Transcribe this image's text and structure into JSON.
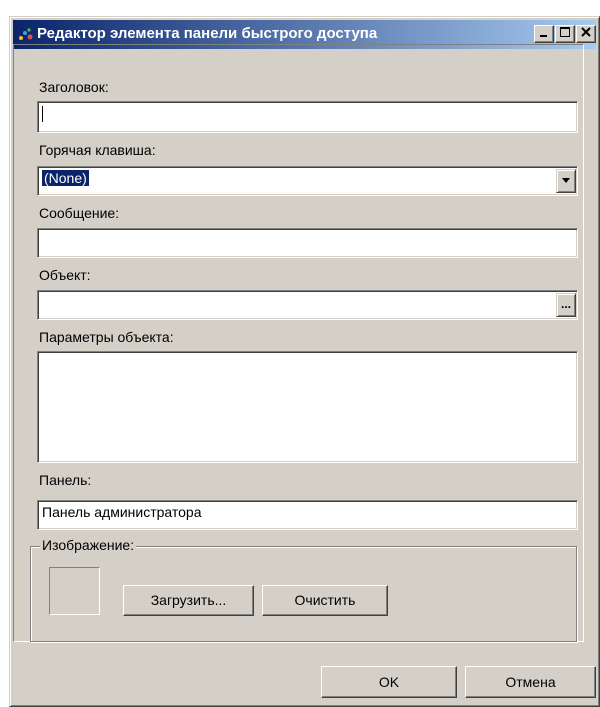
{
  "window": {
    "title": "Редактор элемента панели быстрого доступа",
    "icon": "quick-access-panel-icon",
    "controls": {
      "minimize": "minimize-icon",
      "maximize": "maximize-icon",
      "close": "close-icon"
    }
  },
  "form": {
    "title_label": "Заголовок:",
    "title_value": "",
    "hotkey_label": "Горячая клавиша:",
    "hotkey_value": "(None)",
    "message_label": "Сообщение:",
    "message_value": "",
    "object_label": "Объект:",
    "object_value": "",
    "object_browse": "...",
    "params_label": "Параметры объекта:",
    "params_value": "",
    "panel_label": "Панель:",
    "panel_value": "Панель администратора",
    "image_group": "Изображение:",
    "load_button": "Загрузить...",
    "clear_button": "Очистить"
  },
  "footer": {
    "ok_button": "OK",
    "cancel_button": "Отмена"
  },
  "colors": {
    "face": "#d4d0c8",
    "title_start": "#0a246a",
    "title_end": "#a6caf0",
    "selection": "#0a246a"
  }
}
